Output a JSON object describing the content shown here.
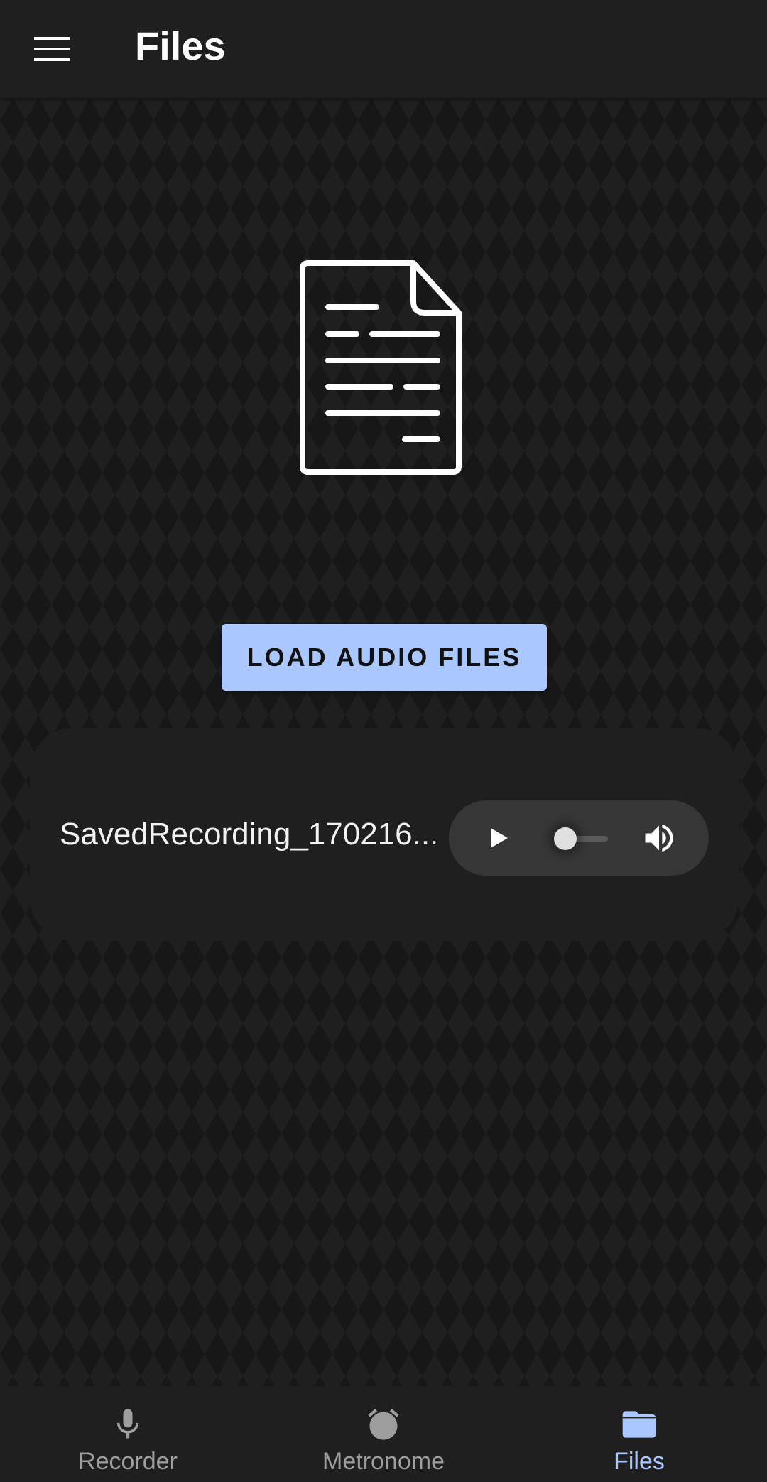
{
  "app_bar": {
    "title": "Files",
    "menu_icon": "hamburger-menu-icon"
  },
  "illustration": {
    "icon": "document-icon"
  },
  "load_button": {
    "label": "LOAD AUDIO FILES"
  },
  "files": [
    {
      "name": "SavedRecording_170216...",
      "player": {
        "play_icon": "play-icon",
        "volume_icon": "volume-up-icon",
        "progress": 0
      }
    }
  ],
  "bottom_nav": {
    "items": [
      {
        "label": "Recorder",
        "icon": "microphone-icon",
        "active": false
      },
      {
        "label": "Metronome",
        "icon": "alarm-clock-icon",
        "active": false
      },
      {
        "label": "Files",
        "icon": "folder-icon",
        "active": true
      }
    ]
  },
  "colors": {
    "accent": "#aac7ff",
    "background": "#1b1b1b",
    "surface": "#1f1f1f",
    "player_surface": "#363636",
    "inactive_nav": "#9e9e9e"
  }
}
